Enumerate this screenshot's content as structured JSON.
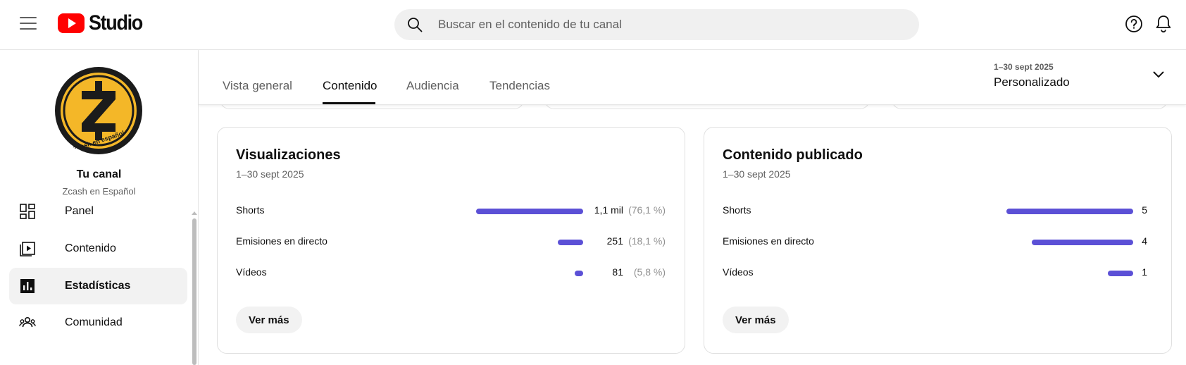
{
  "header": {
    "logo_text": "Studio",
    "search_placeholder": "Buscar en el contenido de tu canal"
  },
  "sidebar": {
    "channel_label": "Tu canal",
    "channel_name": "Zcash en Español",
    "avatar_ring_text": "Zcash en español",
    "avatar_letter": "Ƶ",
    "items": [
      {
        "label": "Panel",
        "icon": "dashboard-icon"
      },
      {
        "label": "Contenido",
        "icon": "content-icon"
      },
      {
        "label": "Estadísticas",
        "icon": "analytics-icon",
        "active": true
      },
      {
        "label": "Comunidad",
        "icon": "community-icon"
      }
    ]
  },
  "tabs": [
    {
      "label": "Vista general"
    },
    {
      "label": "Contenido",
      "active": true
    },
    {
      "label": "Audiencia"
    },
    {
      "label": "Tendencias"
    }
  ],
  "date_range": {
    "range": "1–30 sept 2025",
    "preset": "Personalizado"
  },
  "cards": {
    "views": {
      "title": "Visualizaciones",
      "period": "1–30 sept 2025",
      "rows": [
        {
          "label": "Shorts",
          "value": "1,1 mil",
          "pct": "(76,1 %)",
          "share": 0.761
        },
        {
          "label": "Emisiones en directo",
          "value": "251",
          "pct": "(18,1 %)",
          "share": 0.181
        },
        {
          "label": "Vídeos",
          "value": "81",
          "pct": "(5,8 %)",
          "share": 0.058
        }
      ],
      "button": "Ver más"
    },
    "published": {
      "title": "Contenido publicado",
      "period": "1–30 sept 2025",
      "rows": [
        {
          "label": "Shorts",
          "value": "5",
          "count": 5
        },
        {
          "label": "Emisiones en directo",
          "value": "4",
          "count": 4
        },
        {
          "label": "Vídeos",
          "value": "1",
          "count": 1
        }
      ],
      "button": "Ver más"
    }
  },
  "colors": {
    "bar": "#5b50d6",
    "brand_red": "#ff0000",
    "avatar_yellow": "#f4b728"
  }
}
